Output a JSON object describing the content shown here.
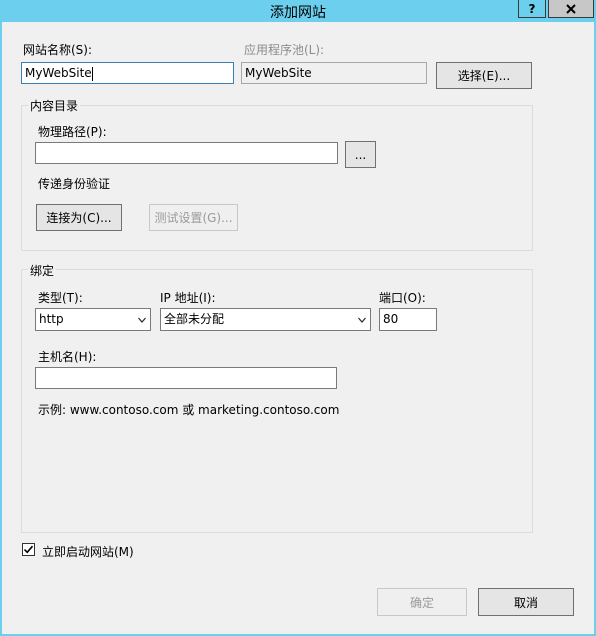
{
  "window": {
    "title": "添加网站",
    "help_label": "?",
    "close_label": "X"
  },
  "site_name": {
    "label": "网站名称(S):",
    "value": "MyWebSite"
  },
  "app_pool": {
    "label": "应用程序池(L):",
    "value": "MyWebSite",
    "select_button": "选择(E)..."
  },
  "content_dir": {
    "group_label": "内容目录",
    "physical_path_label": "物理路径(P):",
    "physical_path_value": "",
    "browse_button": "...",
    "pass_through_label": "传递身份验证",
    "connect_as_button": "连接为(C)...",
    "test_settings_button": "测试设置(G)..."
  },
  "binding": {
    "group_label": "绑定",
    "type_label": "类型(T):",
    "type_value": "http",
    "ip_label": "IP 地址(I):",
    "ip_value": "全部未分配",
    "port_label": "端口(O):",
    "port_value": "80",
    "host_label": "主机名(H):",
    "host_value": "",
    "example_text": "示例: www.contoso.com 或 marketing.contoso.com"
  },
  "start_site": {
    "label": "立即启动网站(M)",
    "checked": true
  },
  "buttons": {
    "ok": "确定",
    "cancel": "取消"
  },
  "icons": {
    "help": "question-mark-icon",
    "close": "close-icon",
    "dropdown": "chevron-down-icon",
    "check": "checkmark-icon"
  }
}
